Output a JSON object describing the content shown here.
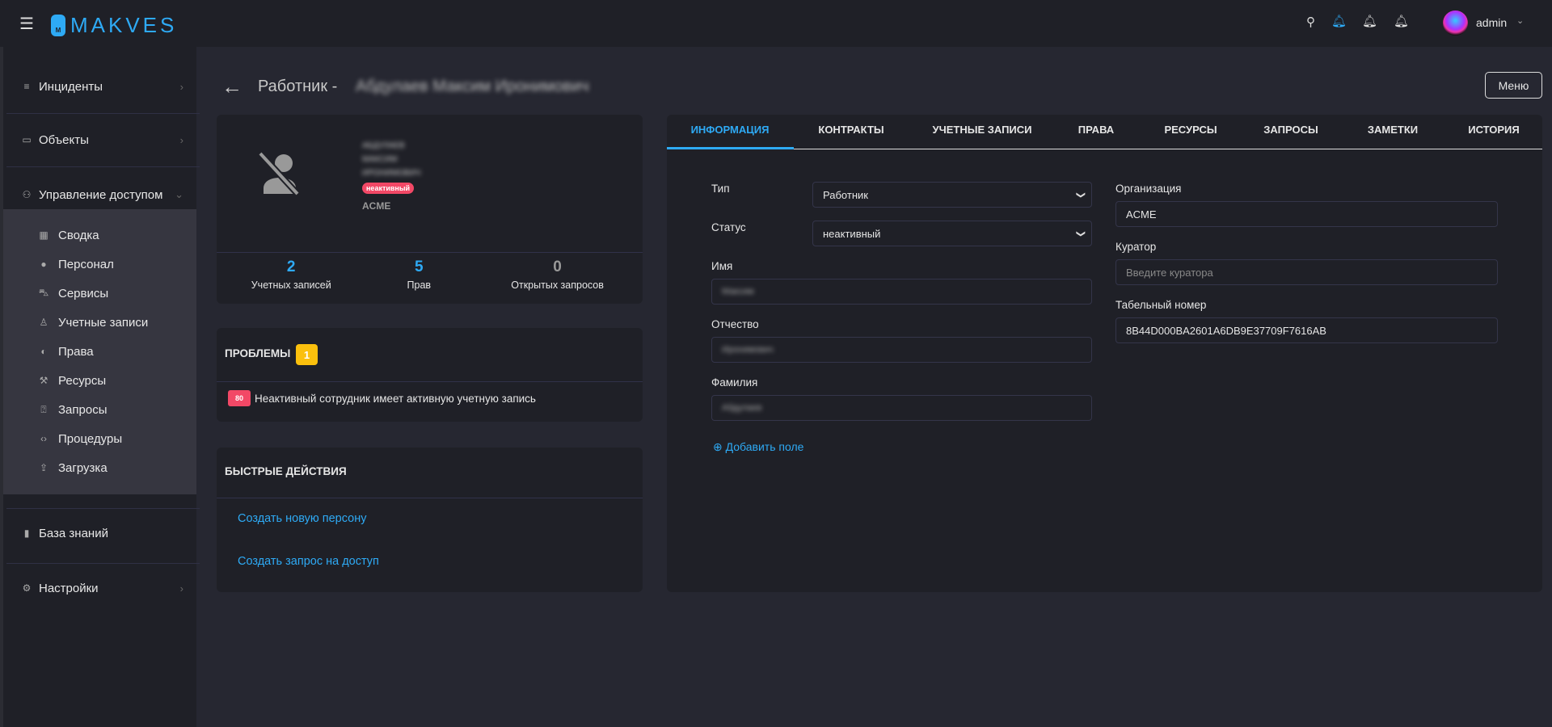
{
  "header": {
    "brand": "MAKVES",
    "logo_letter": "M",
    "user": "admin",
    "accent": "#2eaaf5"
  },
  "sidebar": {
    "items": [
      {
        "label": "Инциденты",
        "icon": "incidents-icon"
      },
      {
        "label": "Объекты",
        "icon": "devices-icon"
      },
      {
        "label": "Управление доступом",
        "icon": "users-icon"
      },
      {
        "label": "База знаний",
        "icon": "book-icon"
      },
      {
        "label": "Настройки",
        "icon": "gear-icon"
      }
    ],
    "submenu": [
      {
        "label": "Сводка",
        "icon": "dashboard-icon"
      },
      {
        "label": "Персонал",
        "icon": "person-icon"
      },
      {
        "label": "Сервисы",
        "icon": "car-icon"
      },
      {
        "label": "Учетные записи",
        "icon": "account-icon"
      },
      {
        "label": "Права",
        "icon": "toggle-icon"
      },
      {
        "label": "Ресурсы",
        "icon": "hammer-icon"
      },
      {
        "label": "Запросы",
        "icon": "question-icon"
      },
      {
        "label": "Процедуры",
        "icon": "code-icon"
      },
      {
        "label": "Загрузка",
        "icon": "upload-icon"
      }
    ]
  },
  "page": {
    "title_prefix": "Работник -",
    "title_name": "Абдулаев Максим Иронимович",
    "menu_label": "Меню"
  },
  "profile": {
    "name_lines": [
      "АБДУЛАЕВ",
      "МАКСИМ",
      "ИРОНИМОВИЧ"
    ],
    "status_badge": "неактивный",
    "org": "ACME",
    "stats": [
      {
        "value": "2",
        "label": "Учетных записей"
      },
      {
        "value": "5",
        "label": "Прав"
      },
      {
        "value": "0",
        "label": "Открытых запросов"
      }
    ]
  },
  "problems": {
    "title": "ПРОБЛЕМЫ",
    "count": "1",
    "items": [
      {
        "score": "80",
        "text": "Неактивный сотрудник имеет активную учетную запись"
      }
    ]
  },
  "quick_actions": {
    "title": "БЫСТРЫЕ ДЕЙСТВИЯ",
    "links": [
      "Создать новую персону",
      "Создать запрос на доступ"
    ]
  },
  "tabs": [
    "ИНФОРМАЦИЯ",
    "КОНТРАКТЫ",
    "УЧЕТНЫЕ ЗАПИСИ",
    "ПРАВА",
    "РЕСУРСЫ",
    "ЗАПРОСЫ",
    "ЗАМЕТКИ",
    "ИСТОРИЯ"
  ],
  "form": {
    "type": {
      "label": "Тип",
      "value": "Работник"
    },
    "status": {
      "label": "Статус",
      "value": "неактивный"
    },
    "first_name": {
      "label": "Имя",
      "value": "Максим"
    },
    "patronymic": {
      "label": "Отчество",
      "value": "Иронимович"
    },
    "last_name": {
      "label": "Фамилия",
      "value": "Абдулаев"
    },
    "add_field": "Добавить поле",
    "org": {
      "label": "Организация",
      "value": "ACME"
    },
    "curator": {
      "label": "Куратор",
      "placeholder": "Введите куратора"
    },
    "tab_number": {
      "label": "Табельный номер",
      "value": "8B44D000BA2601A6DB9E37709F7616AB"
    }
  }
}
